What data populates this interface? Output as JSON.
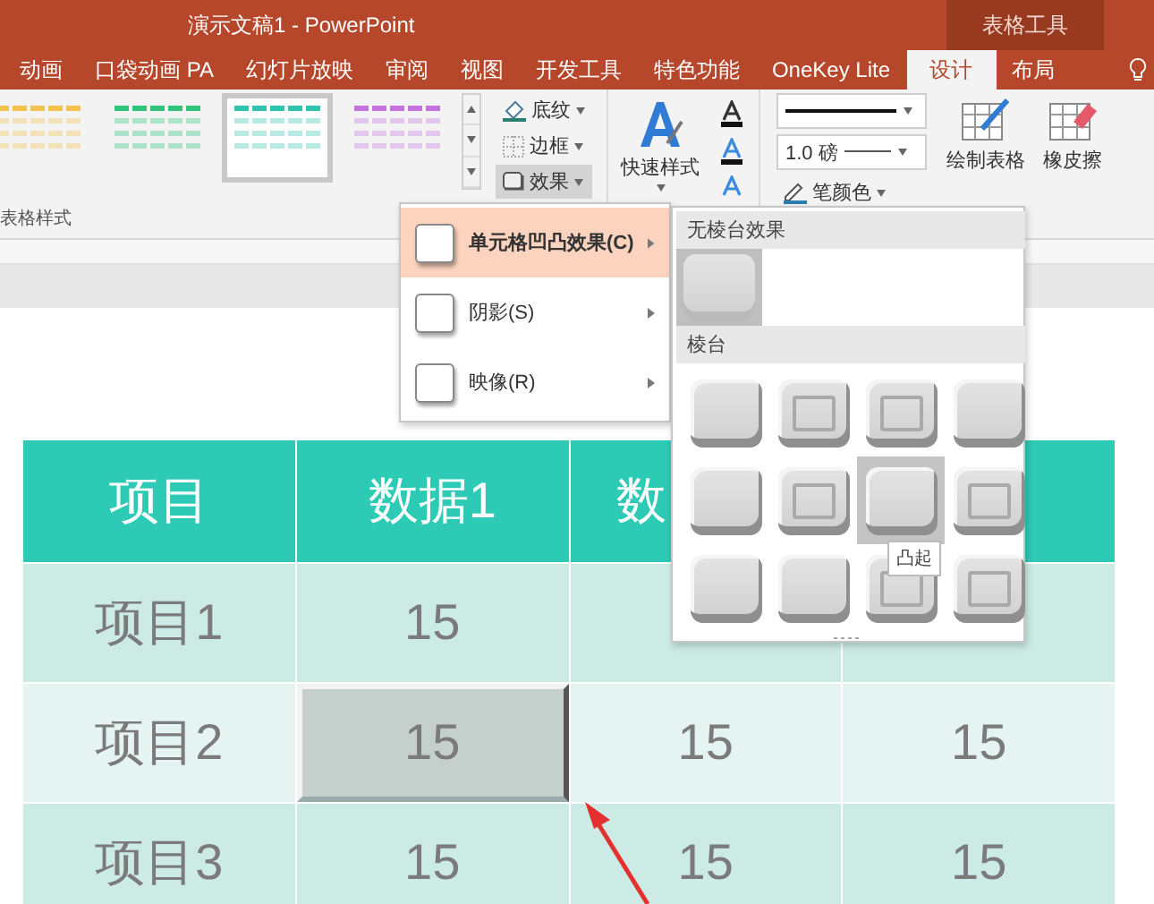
{
  "window": {
    "title": "演示文稿1 - PowerPoint",
    "context_tab": "表格工具"
  },
  "tabs": [
    {
      "label": "动画",
      "selected": false
    },
    {
      "label": "口袋动画 PA",
      "selected": false
    },
    {
      "label": "幻灯片放映",
      "selected": false
    },
    {
      "label": "审阅",
      "selected": false
    },
    {
      "label": "视图",
      "selected": false
    },
    {
      "label": "开发工具",
      "selected": false
    },
    {
      "label": "特色功能",
      "selected": false
    },
    {
      "label": "OneKey Lite",
      "selected": false
    },
    {
      "label": "设计",
      "selected": true
    },
    {
      "label": "布局",
      "selected": false
    }
  ],
  "ribbon": {
    "styles": [
      {
        "color": "#f2c14e",
        "selected": false
      },
      {
        "color": "#2fc47a",
        "selected": false
      },
      {
        "color": "#2ec4b0",
        "selected": true
      },
      {
        "color": "#c774e0",
        "selected": false
      }
    ],
    "group_label": "表格样式",
    "table_buttons": [
      {
        "label": "底纹",
        "pressed": false
      },
      {
        "label": "边框",
        "pressed": false
      },
      {
        "label": "效果",
        "pressed": true
      }
    ],
    "quick_styles": "快速样式",
    "pen_weight": "1.0 磅",
    "pen_color": "笔颜色",
    "draw_table": "绘制表格",
    "eraser": "橡皮擦"
  },
  "effects_menu": {
    "items": [
      {
        "label": "单元格凹凸效果(C)",
        "selected": true
      },
      {
        "label": "阴影(S)",
        "selected": false
      },
      {
        "label": "映像(R)",
        "selected": false
      }
    ]
  },
  "bevel_gallery": {
    "none_header": "无棱台效果",
    "none_selected": true,
    "header": "棱台",
    "tooltip": "凸起",
    "presets": [
      {
        "selected": false
      },
      {
        "selected": false
      },
      {
        "selected": false
      },
      {
        "selected": false
      },
      {
        "selected": false
      },
      {
        "selected": false
      },
      {
        "selected": true
      },
      {
        "selected": false
      },
      {
        "selected": false
      },
      {
        "selected": false
      },
      {
        "selected": false
      },
      {
        "selected": false
      }
    ]
  },
  "table": {
    "columns": [
      {
        "label": "项目",
        "clipped": false
      },
      {
        "label": "数据1",
        "clipped": false
      },
      {
        "label": "数",
        "clipped": true
      },
      {}
    ],
    "rows": [
      {
        "cells": [
          {
            "text": "项目1",
            "selected": false
          },
          {
            "text": "15",
            "selected": false
          },
          {
            "selected": false
          },
          {
            "selected": false
          }
        ]
      },
      {
        "cells": [
          {
            "text": "项目2",
            "selected": false
          },
          {
            "text": "15",
            "selected": true
          },
          {
            "text": "15",
            "selected": false
          },
          {
            "text": "15",
            "selected": false
          }
        ]
      },
      {
        "cells": [
          {
            "text": "项目3",
            "selected": false
          },
          {
            "text": "15",
            "selected": false
          },
          {
            "text": "15",
            "selected": false
          },
          {
            "text": "15",
            "selected": false
          }
        ]
      }
    ]
  }
}
